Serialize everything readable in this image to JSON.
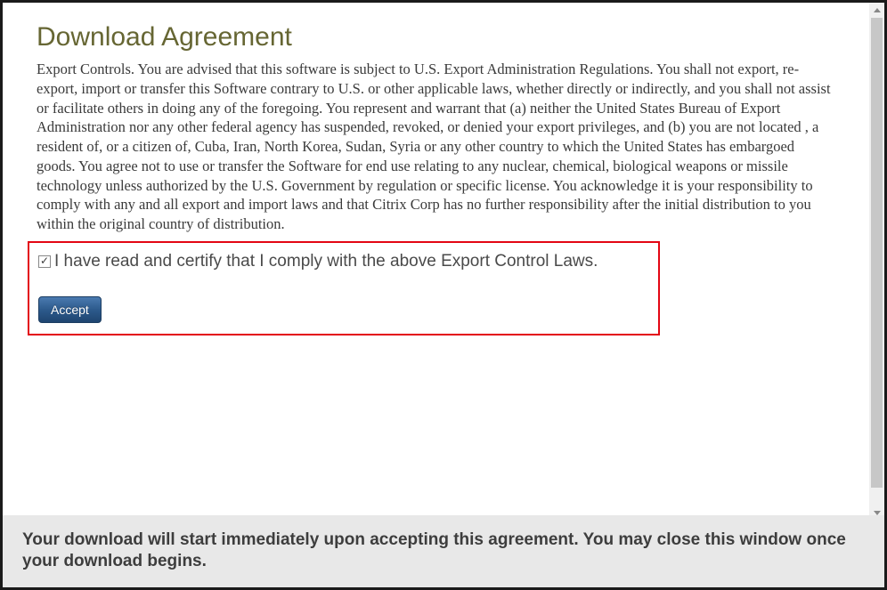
{
  "title": "Download Agreement",
  "body": "Export Controls. You are advised that this software is subject to U.S. Export Administration Regulations. You shall not export, re-export, import or transfer this Software contrary to U.S. or other applicable laws, whether directly or indirectly, and you shall not assist or facilitate others in doing any of the foregoing. You represent and warrant that (a) neither the United States Bureau of Export Administration nor any other federal agency has suspended, revoked, or denied your export privileges, and (b) you are not located , a resident of, or a citizen of, Cuba, Iran, North Korea, Sudan, Syria or any other country to which the United States has embargoed goods. You agree not to use or transfer the Software for end use relating to any nuclear, chemical, biological weapons or missile technology unless authorized by the U.S. Government by regulation or specific license. You acknowledge it is your responsibility to comply with any and all export and import laws and that Citrix Corp has no further responsibility after the initial distribution to you within the original country of distribution.",
  "consent": {
    "checked": true,
    "label": "I have read and certify that I comply with the above Export Control Laws."
  },
  "accept_label": "Accept",
  "footer": "Your download will start immediately upon accepting this agreement. You may close this window once your download begins."
}
